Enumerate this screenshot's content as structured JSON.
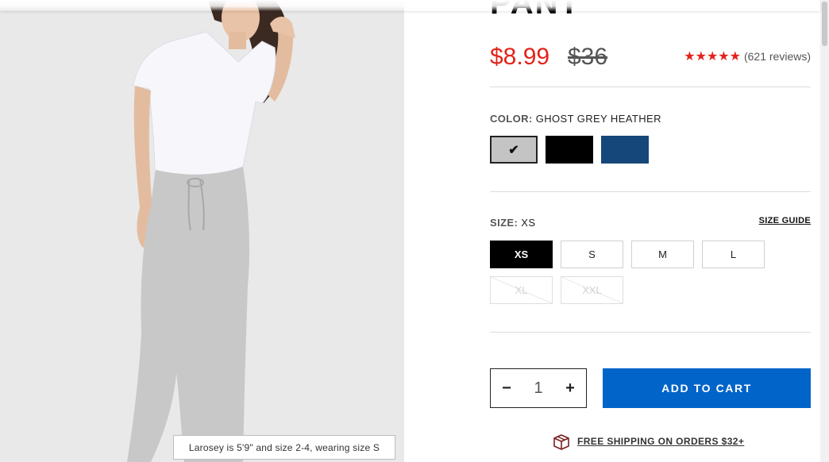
{
  "product": {
    "title_partial": "PANT",
    "price_sale": "$8.99",
    "price_original": "$36",
    "rating_stars": "★★★★★",
    "rating_value": 5,
    "review_count": "(621 reviews)"
  },
  "color": {
    "label": "COLOR:",
    "selected": "GHOST GREY HEATHER",
    "swatches": [
      {
        "name": "ghost-grey-heather",
        "hex": "#c4c4c4",
        "selected": true
      },
      {
        "name": "black",
        "hex": "#000000",
        "selected": false
      },
      {
        "name": "navy",
        "hex": "#15477a",
        "selected": false
      }
    ],
    "check_glyph": "✔"
  },
  "size": {
    "label": "SIZE:",
    "selected": "XS",
    "guide_label": "SIZE GUIDE",
    "options": [
      {
        "label": "XS",
        "state": "selected"
      },
      {
        "label": "S",
        "state": "available"
      },
      {
        "label": "M",
        "state": "available"
      },
      {
        "label": "L",
        "state": "available"
      },
      {
        "label": "XL",
        "state": "unavailable"
      },
      {
        "label": "XXL",
        "state": "unavailable"
      }
    ]
  },
  "quantity": {
    "minus": "−",
    "value": "1",
    "plus": "+"
  },
  "cart": {
    "add_label": "ADD TO CART",
    "button_color": "#0064c8"
  },
  "shipping": {
    "icon": "box-icon",
    "text": "FREE SHIPPING ON ORDERS $32+"
  },
  "image": {
    "caption": "Larosey is 5'9\" and size 2-4, wearing size S"
  },
  "colors": {
    "sale": "#e2231a",
    "accent": "#0064c8"
  }
}
